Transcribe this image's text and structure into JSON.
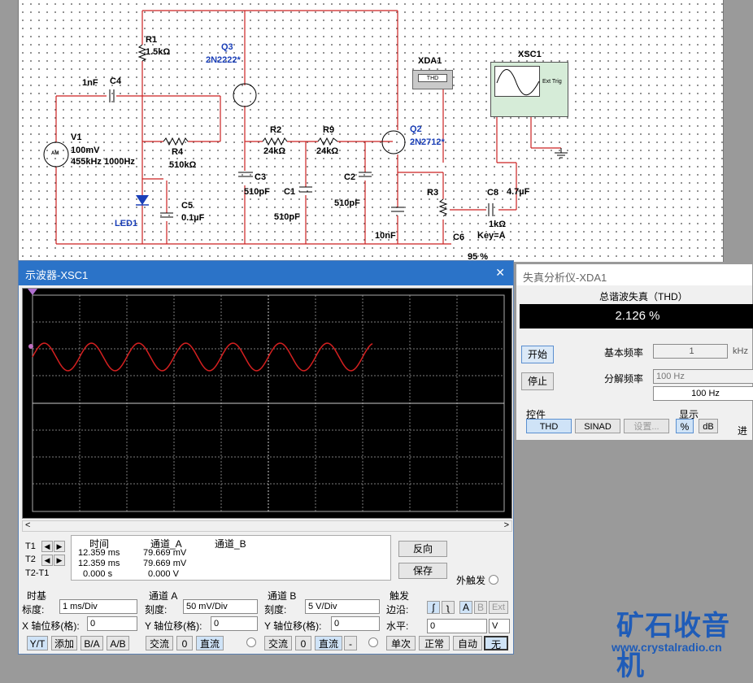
{
  "schematic": {
    "labels": {
      "r1": "R1",
      "r1_val": "1.5kΩ",
      "q3": "Q3",
      "q3_model": "2N2222*",
      "c4_val": "1nF",
      "c4": "C4",
      "xda1": "XDA1",
      "thd_box": "THD",
      "xsc1": "XSC1",
      "ext_trig": "Ext Trig",
      "v1": "V1",
      "v1_amp": "100mV",
      "v1_freq": "455kHz 1000Hz",
      "v1_sym": "AM",
      "r4": "R4",
      "r4_val": "510kΩ",
      "r2": "R2",
      "r2_val": "24kΩ",
      "r9": "R9",
      "r9_val": "24kΩ",
      "q2": "Q2",
      "q2_model": "2N2712*",
      "c3": "C3",
      "c3_val": "510pF",
      "c1": "C1",
      "c1_val": "510pF",
      "c2": "C2",
      "c2_val": "510pF",
      "r3": "R3",
      "c8": "C8",
      "c8_val": "4.7µF",
      "r3_val": "1kΩ",
      "c6": "C6",
      "c6_val": "10nF",
      "key": "Key=A",
      "c5": "C5",
      "c5_val": "0.1µF",
      "led1": "LED1",
      "percent": "95 %"
    }
  },
  "scope": {
    "title": "示波器-XSC1",
    "close": "✕",
    "readout": {
      "headers": [
        "时间",
        "通道_A",
        "通道_B"
      ],
      "t1_label": "T1",
      "t2_label": "T2",
      "t21_label": "T2-T1",
      "rows": [
        {
          "time": "12.359 ms",
          "a": "79.669 mV",
          "b": ""
        },
        {
          "time": "12.359 ms",
          "a": "79.669 mV",
          "b": ""
        },
        {
          "time": "0.000 s",
          "a": "0.000 V",
          "b": ""
        }
      ]
    },
    "buttons": {
      "reverse": "反向",
      "save": "保存",
      "ext_trigger": "外触发"
    },
    "timebase": {
      "title": "时基",
      "scale_label": "标度:",
      "scale": "1 ms/Div",
      "xpos_label": "X 轴位移(格):",
      "xpos": "0",
      "yt": "Y/T",
      "add": "添加",
      "ba": "B/A",
      "ab": "A/B"
    },
    "channel_a": {
      "title": "通道 A",
      "scale_label": "刻度:",
      "scale": "50 mV/Div",
      "ypos_label": "Y 轴位移(格):",
      "ypos": "0",
      "ac": "交流",
      "zero": "0",
      "dc": "直流"
    },
    "channel_b": {
      "title": "通道 B",
      "scale_label": "刻度:",
      "scale": "5  V/Div",
      "ypos_label": "Y 轴位移(格):",
      "ypos": "0",
      "ac": "交流",
      "zero": "0",
      "dc": "直流",
      "minus": "-"
    },
    "trigger": {
      "title": "触发",
      "edge_label": "边沿:",
      "a": "A",
      "b": "B",
      "ext": "Ext",
      "level_label": "水平:",
      "level": "0",
      "unit": "V",
      "single": "单次",
      "normal": "正常",
      "auto": "自动",
      "none": "无"
    },
    "colors": {
      "trace": "#d42020",
      "screen": "#000000",
      "grid": "#8a8a8a"
    }
  },
  "distortion": {
    "title": "失真分析仪-XDA1",
    "thd_title": "总谐波失真（THD）",
    "thd_value": "2.126 %",
    "start": "开始",
    "stop": "停止",
    "fund_label": "基本频率",
    "fund_value": "1",
    "fund_unit": "kHz",
    "res_label": "分解频率",
    "res_value": "100 Hz",
    "res_display": "100 Hz",
    "controls_title": "控件",
    "thd_btn": "THD",
    "sinad_btn": "SINAD",
    "settings_btn": "设置...",
    "display_title": "显示",
    "pct_btn": "%",
    "db_btn": "dB",
    "cut_text": "进"
  },
  "watermark": {
    "brand": "矿石收音机",
    "url": "www.crystalradio.cn"
  }
}
